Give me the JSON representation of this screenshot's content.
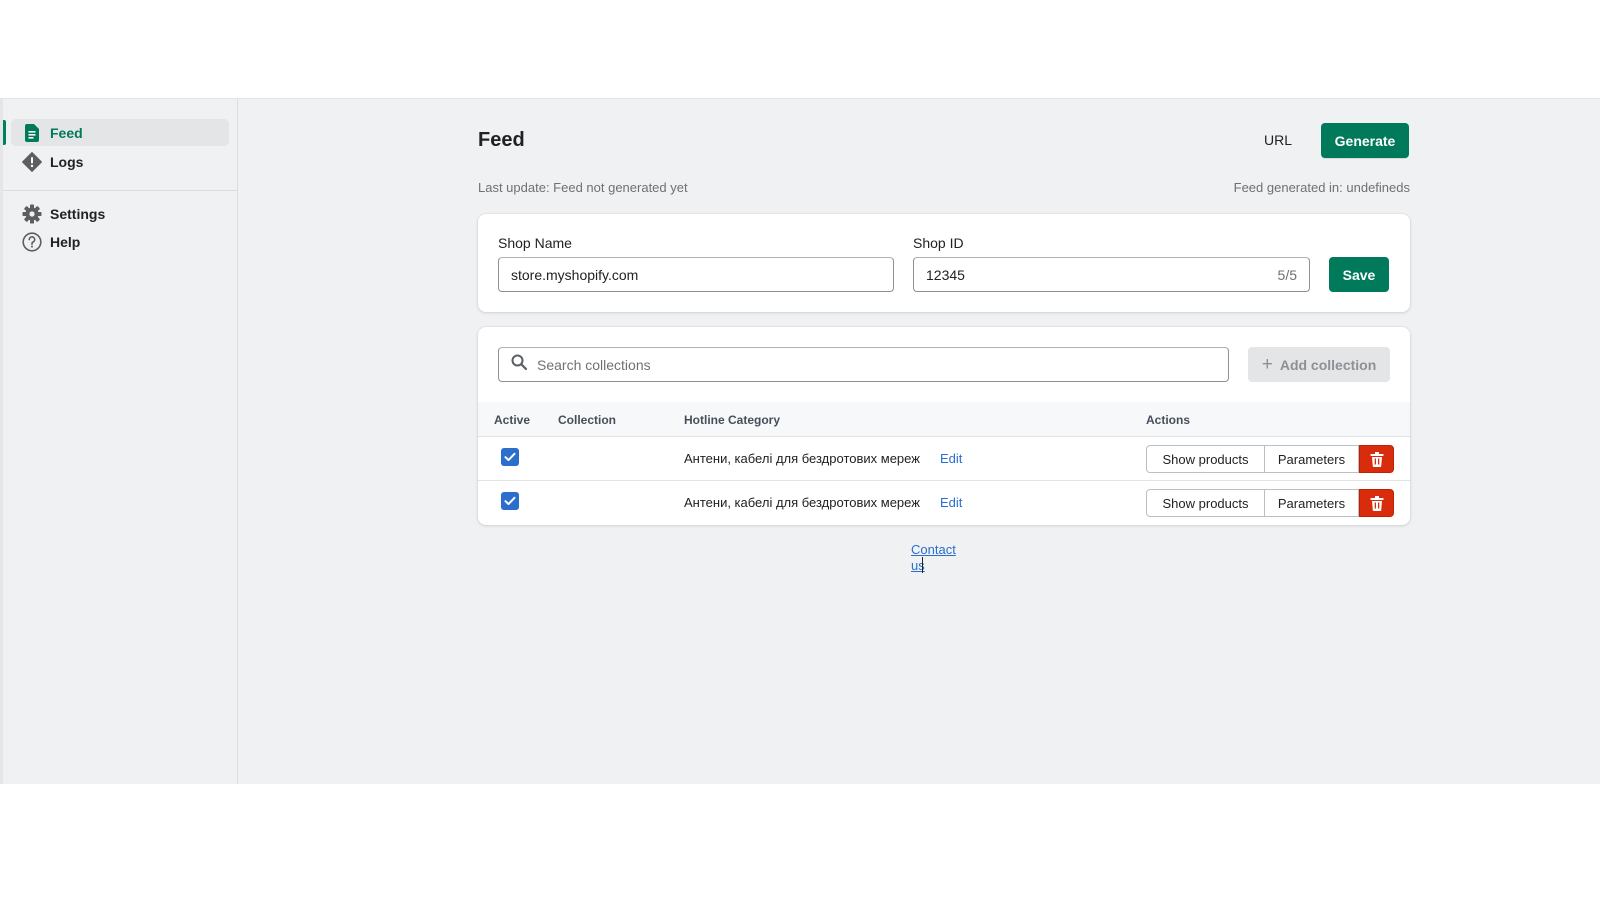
{
  "sidebar": {
    "items": [
      {
        "label": "Feed",
        "icon": "document-icon",
        "active": true
      },
      {
        "label": "Logs",
        "icon": "alert-diamond-icon",
        "active": false
      },
      {
        "label": "Settings",
        "icon": "gear-icon",
        "active": false
      },
      {
        "label": "Help",
        "icon": "question-circle-icon",
        "active": false
      }
    ]
  },
  "header": {
    "title": "Feed",
    "url_label": "URL",
    "generate_label": "Generate",
    "last_update": "Last update: Feed not generated yet",
    "generated_in": "Feed generated in: undefineds"
  },
  "shop_form": {
    "shop_name_label": "Shop Name",
    "shop_name_value": "store.myshopify.com",
    "shop_id_label": "Shop ID",
    "shop_id_value": "12345",
    "shop_id_counter": "5/5",
    "save_label": "Save"
  },
  "collections": {
    "search_placeholder": "Search collections",
    "add_label": "Add collection",
    "columns": [
      "Active",
      "Collection",
      "Hotline Category",
      "Actions"
    ],
    "rows": [
      {
        "active": true,
        "collection": "",
        "category": "Антени, кабелі для бездротових мереж",
        "edit_label": "Edit",
        "show_products_label": "Show products",
        "parameters_label": "Parameters"
      },
      {
        "active": true,
        "collection": "",
        "category": "Антени, кабелі для бездротових мереж",
        "edit_label": "Edit",
        "show_products_label": "Show products",
        "parameters_label": "Parameters"
      }
    ]
  },
  "footer": {
    "contact_label": "Contact us"
  },
  "colors": {
    "primary": "#007a5a",
    "link": "#2c6ecb",
    "danger": "#d82c0d",
    "background": "#f0f1f3"
  }
}
